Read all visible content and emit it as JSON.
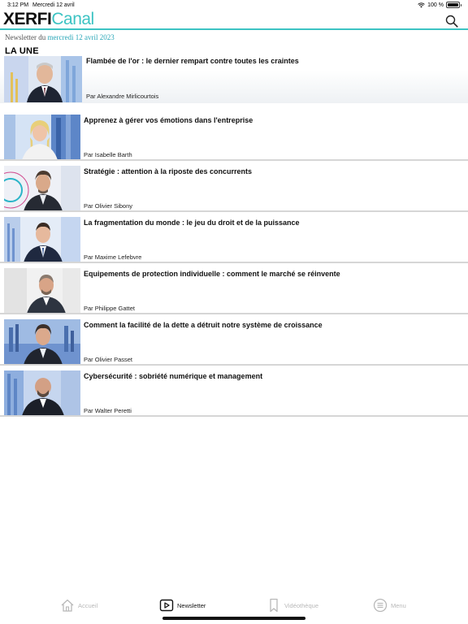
{
  "status_bar": {
    "time": "3:12 PM",
    "date": "Mercredi 12 avril",
    "battery": "100 %"
  },
  "header": {
    "logo_part1": "XERFI",
    "logo_part2": "Canal",
    "search_icon": "search-icon",
    "accent_color": "#3cc3c3"
  },
  "newsletter": {
    "prefix": "Newsletter du",
    "date": "mercredi 12 avril 2023"
  },
  "section_title": "LA UNE",
  "featured": {
    "title": "Flambée de l'or : le dernier rempart contre toutes les craintes",
    "author": "Par Alexandre Mirlicourtois"
  },
  "articles": [
    {
      "title": "Apprenez à gérer vos émotions dans l'entreprise",
      "author": "Par Isabelle Barth"
    },
    {
      "title": "Stratégie : attention à la riposte des concurrents",
      "author": "Par Olivier Sibony"
    },
    {
      "title": "La fragmentation du monde : le jeu du droit et de la puissance",
      "author": "Par Maxime Lefebvre"
    },
    {
      "title": "Equipements de protection individuelle : comment le marché se réinvente",
      "author": "Par Philippe Gattet"
    },
    {
      "title": "Comment la facilité de la dette a détruit notre système de croissance",
      "author": "Par Olivier Passet"
    },
    {
      "title": "Cybersécurité : sobriété numérique et management",
      "author": "Par Walter Peretti"
    }
  ],
  "tab_bar": {
    "tabs": [
      {
        "label": "Accueil",
        "icon": "home-icon"
      },
      {
        "label": "Newsletter",
        "icon": "play-square-icon"
      },
      {
        "label": "Vidéothèque",
        "icon": "bookmark-icon"
      },
      {
        "label": "Menu",
        "icon": "menu-circle-icon"
      }
    ],
    "active": "Newsletter"
  }
}
